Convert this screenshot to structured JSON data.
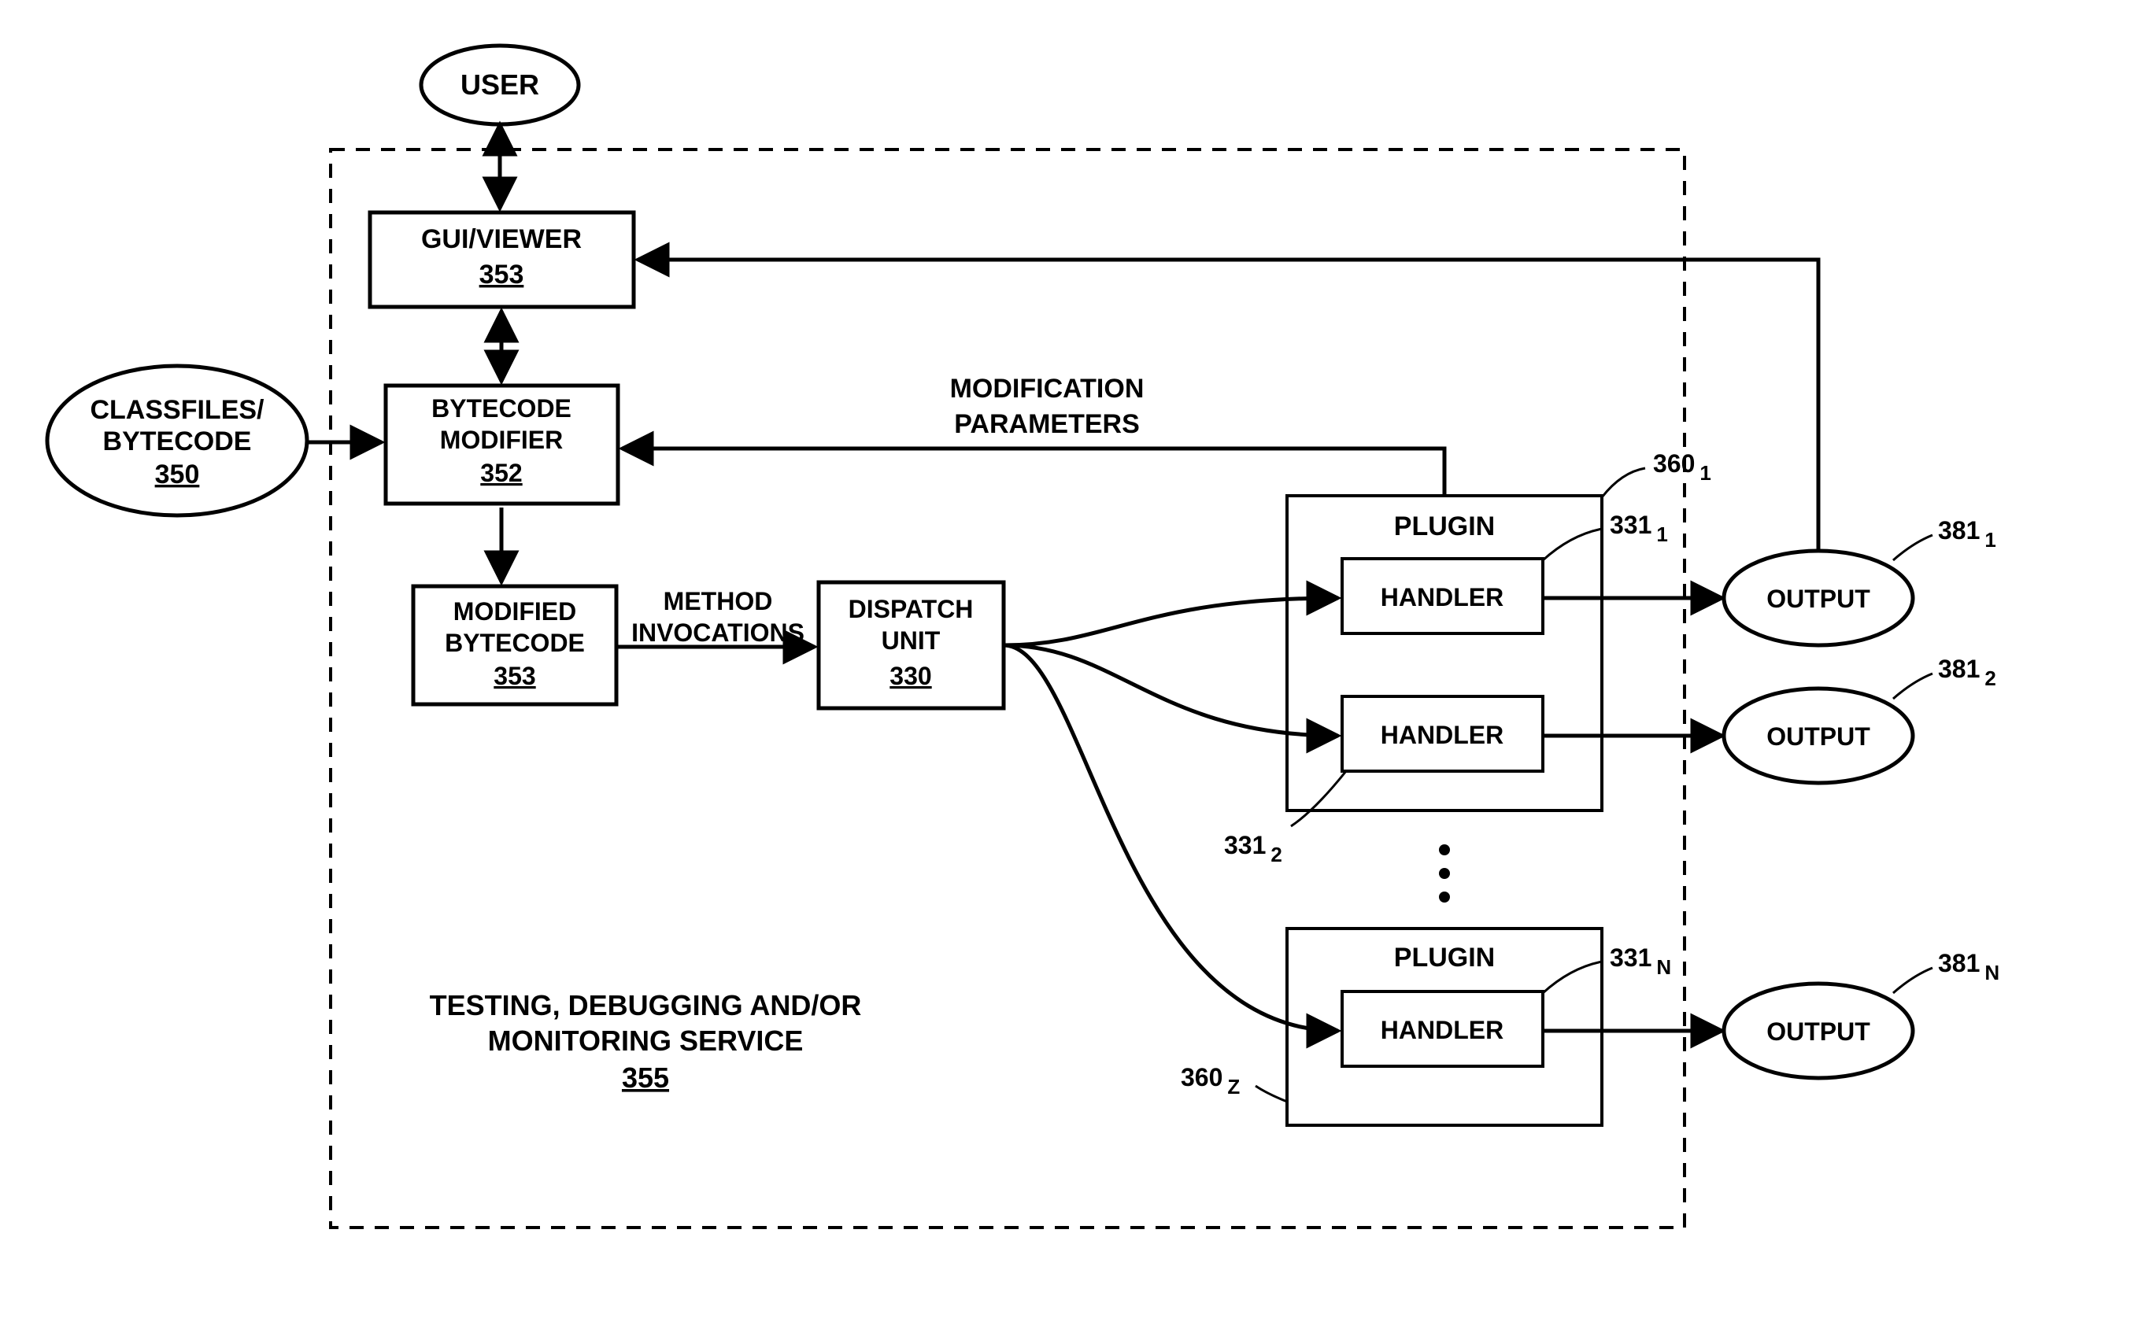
{
  "diagram": {
    "user": "USER",
    "classfiles": {
      "l1": "CLASSFILES/",
      "l2": "BYTECODE",
      "ref": "350"
    },
    "guiviewer": {
      "title": "GUI/VIEWER",
      "ref": "353"
    },
    "modifier": {
      "l1": "BYTECODE",
      "l2": "MODIFIER",
      "ref": "352"
    },
    "modified": {
      "l1": "MODIFIED",
      "l2": "BYTECODE",
      "ref": "353"
    },
    "method_invocations": {
      "l1": "METHOD",
      "l2": "INVOCATIONS"
    },
    "dispatch": {
      "l1": "DISPATCH",
      "l2": "UNIT",
      "ref": "330"
    },
    "mod_params": {
      "l1": "MODIFICATION",
      "l2": "PARAMETERS"
    },
    "plugin_label": "PLUGIN",
    "handler_label": "HANDLER",
    "plugin_refs": {
      "p1": "360",
      "p1sub": "1",
      "p2": "360",
      "p2sub": "Z"
    },
    "handler_refs": {
      "h1": "331",
      "h1sub": "1",
      "h2": "331",
      "h2sub": "2",
      "hn": "331",
      "hnsub": "N"
    },
    "output_label": "OUTPUT",
    "output_refs": {
      "o1": "381",
      "o1sub": "1",
      "o2": "381",
      "o2sub": "2",
      "on": "381",
      "onsub": "N"
    },
    "service": {
      "l1": "TESTING, DEBUGGING AND/OR",
      "l2": "MONITORING SERVICE",
      "ref": "355"
    }
  }
}
